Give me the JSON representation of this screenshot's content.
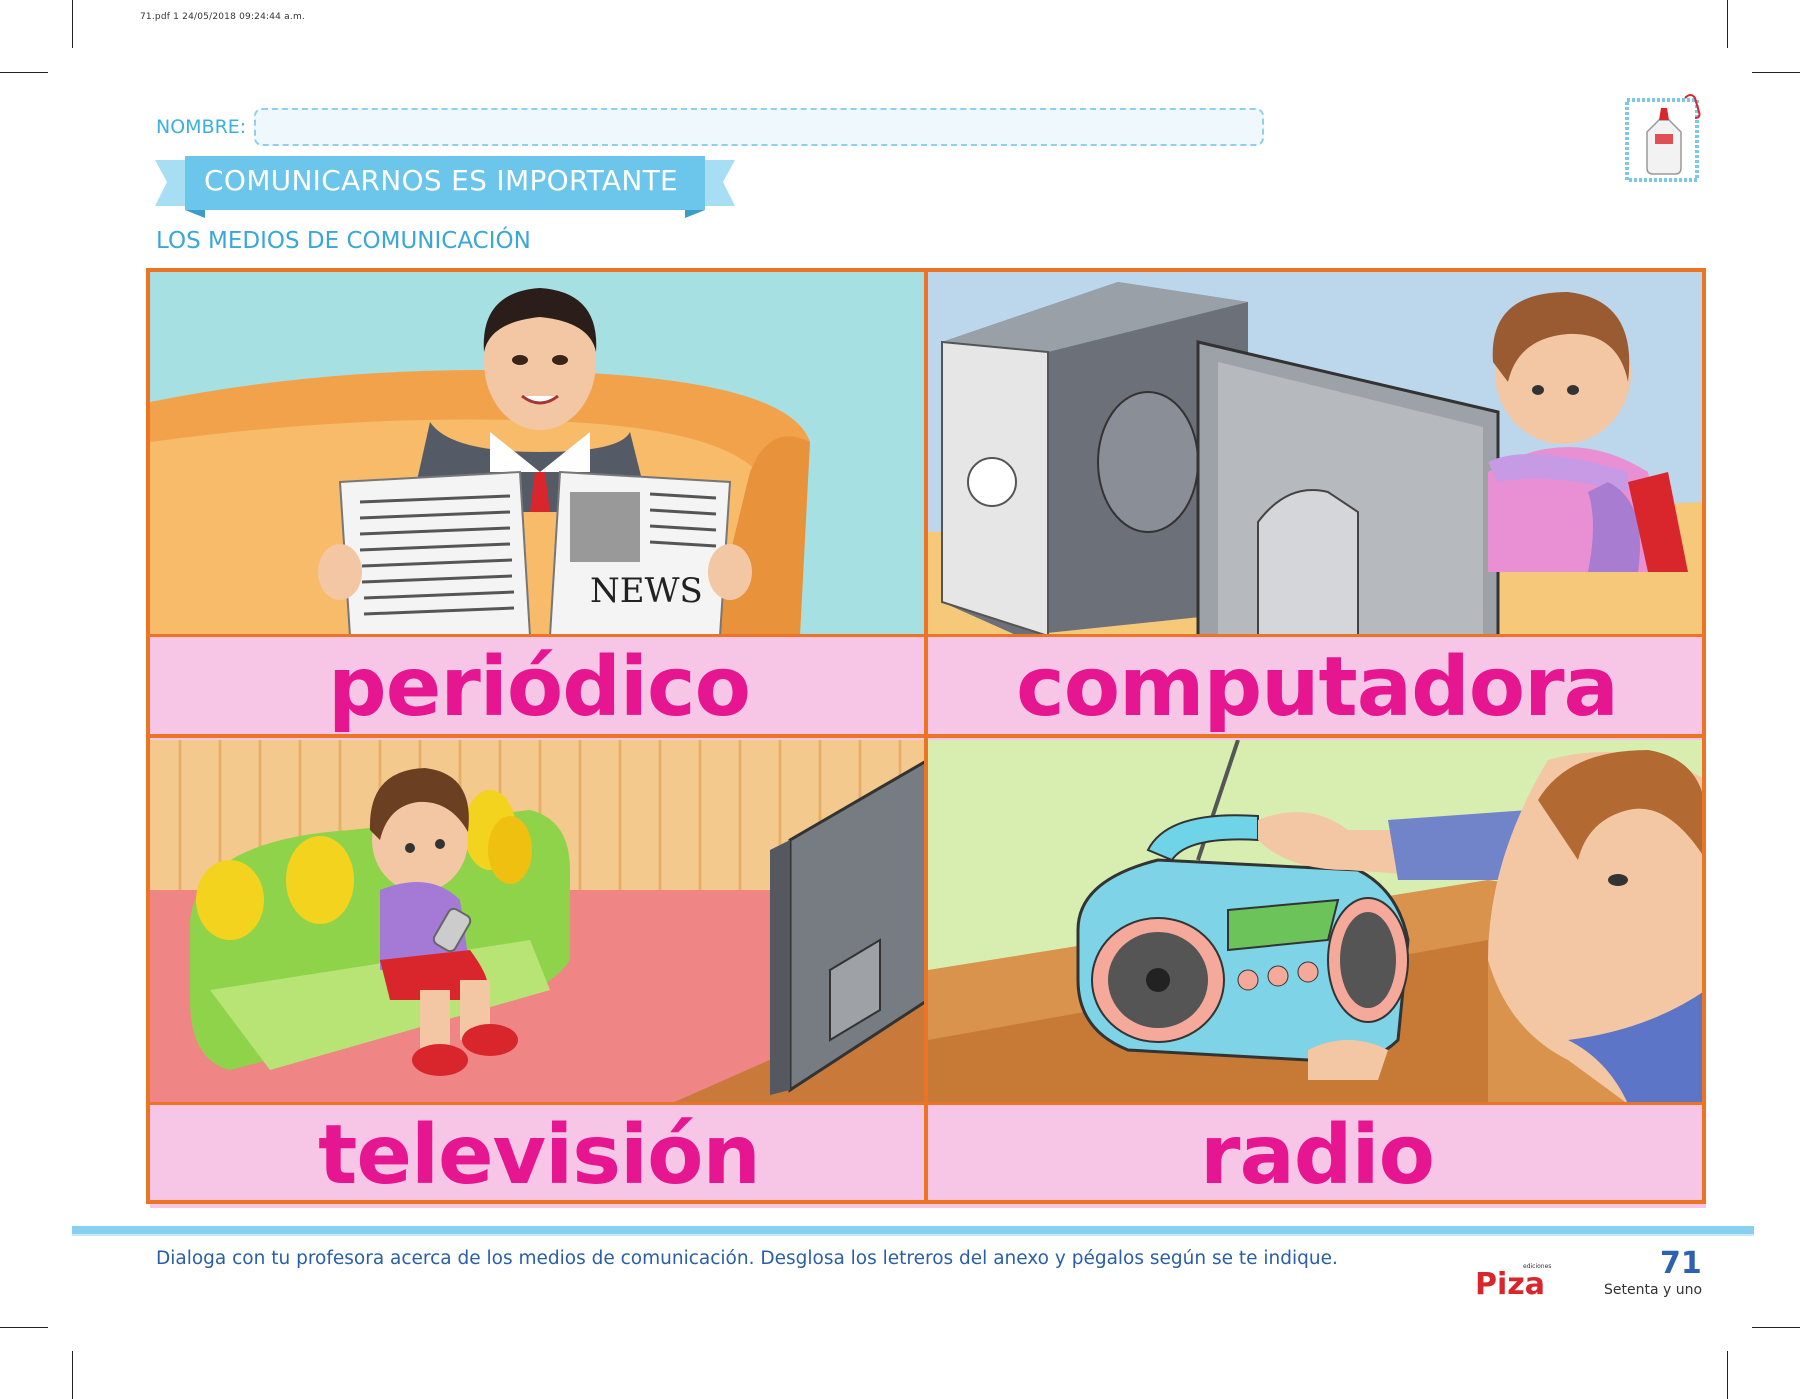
{
  "file_stamp": "71.pdf   1   24/05/2018   09:24:44 a.m.",
  "header": {
    "name_label": "NOMBRE:",
    "title": "COMUNICARNOS ES IMPORTANTE",
    "subtitle": "LOS MEDIOS DE COMUNICACIÓN",
    "activity_icon": "glue-bottle-icon"
  },
  "cards": [
    {
      "label": "periódico",
      "scene": "man-reading-newspaper",
      "newspaper_text": "NEWS"
    },
    {
      "label": "computadora",
      "scene": "child-at-computer"
    },
    {
      "label": "televisión",
      "scene": "boy-watching-tv"
    },
    {
      "label": "radio",
      "scene": "man-tuning-radio"
    }
  ],
  "footer": {
    "instructions": "Dialoga con tu profesora acerca de los medios de comunicación. Desglosa los letreros del anexo y pégalos según se te indique.",
    "publisher": "Piza",
    "publisher_small": "ediciones",
    "page_number": "71",
    "page_words": "Setenta y uno"
  },
  "colors": {
    "accent_blue": "#3bb0de",
    "banner_blue": "#6cc5ea",
    "grid_orange": "#ec7425",
    "label_pink": "#f7c6e6",
    "label_text": "#e5168f"
  }
}
